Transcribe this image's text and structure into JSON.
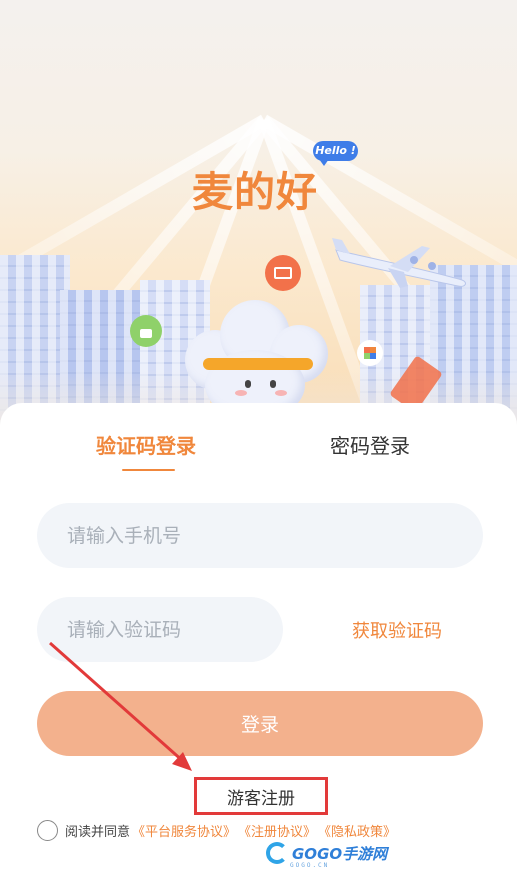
{
  "hero": {
    "brand_name": "麦的好",
    "hello_badge": "Hello !"
  },
  "tabs": [
    {
      "label": "验证码登录",
      "active": true
    },
    {
      "label": "密码登录",
      "active": false
    }
  ],
  "form": {
    "phone_placeholder": "请输入手机号",
    "code_placeholder": "请输入验证码",
    "get_code_label": "获取验证码",
    "login_label": "登录",
    "guest_register_label": "游客注册"
  },
  "agreement": {
    "prefix": "阅读并同意",
    "links": [
      "《平台服务协议》",
      "《注册协议》",
      "《隐私政策》"
    ],
    "checked": false
  },
  "watermark": {
    "text": "GOGO手游网",
    "sub": "GOGO.CN"
  },
  "colors": {
    "accent": "#f0873c",
    "login_button": "#f3b18d",
    "field_bg": "#f2f5f9",
    "highlight_box": "#e23a3a"
  }
}
